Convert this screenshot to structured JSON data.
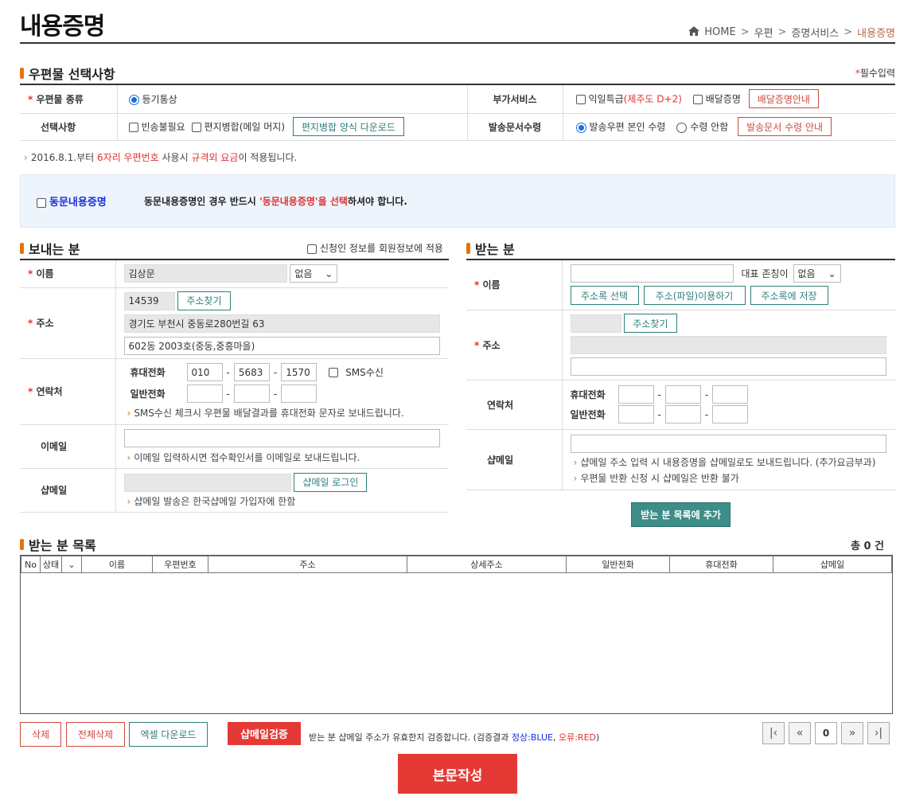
{
  "page": {
    "title": "내용증명"
  },
  "breadcrumb": {
    "home": "HOME",
    "sep": ">",
    "b1": "우편",
    "b2": "증명서비스",
    "b3": "내용증명"
  },
  "options": {
    "section": "우편물 선택사항",
    "required_mark": "*",
    "required_note": "필수입력",
    "mail_type_label": "우편물 종류",
    "mail_type_value": "등기통상",
    "extra_label": "부가서비스",
    "express_label": "익일특급",
    "express_note": "(제주도 D+2)",
    "delivery_proof": "배달증명",
    "delivery_guide_btn": "배달증명안내",
    "select_label": "선택사항",
    "empty_ok": "빈송불필요",
    "merge": "편지병합(메일 머지)",
    "merge_download_btn": "편지병합 양식 다운로드",
    "doc_receive_label": "발송문서수령",
    "doc_self": "발송우편 본인 수령",
    "doc_none": "수령 안함",
    "doc_guide_btn": "발송문서 수령 안내"
  },
  "notice": {
    "pre": "2016.8.1.부터 ",
    "red1": "6자리 우편번호",
    "mid": " 사용시 ",
    "red2": "규격외 요금",
    "post": "이 적용됩니다."
  },
  "same": {
    "label": "동문내용증명",
    "pre": "동문내용증명인 경우 반드시 ",
    "red": "'동문내용증명'을 선택",
    "post": "하셔야 합니다."
  },
  "sender": {
    "section": "보내는 분",
    "apply_member": "신청인 정보를 회원정보에 적용",
    "name_label": "이름",
    "name_value": "김상문",
    "title_select": "없음",
    "addr_label": "주소",
    "zip": "14539",
    "find_addr_btn": "주소찾기",
    "addr1": "경기도 부천시 중동로280번길 63",
    "addr2": "602동 2003호(중동,중흥마을)",
    "contact_label": "연락처",
    "mobile_label": "휴대전화",
    "mobile1": "010",
    "mobile2": "5683",
    "mobile3": "1570",
    "sms_label": "SMS수신",
    "phone_label": "일반전화",
    "dash": "-",
    "sms_hint": "SMS수신 체크시 우편물 배달결과를 휴대전화 문자로 보내드립니다.",
    "email_label": "이메일",
    "email_hint": "이메일 입력하시면 접수확인서를 이메일로 보내드립니다.",
    "shopmail_label": "샵메일",
    "shopmail_login_btn": "샵메일 로그인",
    "shopmail_hint": "샵메일 발송은 한국샵메일 가입자에 한함"
  },
  "receiver": {
    "section": "받는 분",
    "name_label": "이름",
    "honorific_label": "대표 존칭이",
    "honorific_select": "없음",
    "addrbook_btn": "주소록 선택",
    "file_btn": "주소(파일)이용하기",
    "save_btn": "주소록에 저장",
    "addr_label": "주소",
    "find_addr_btn": "주소찾기",
    "contact_label": "연락처",
    "mobile_label": "휴대전화",
    "phone_label": "일반전화",
    "dash": "-",
    "shopmail_label": "샵메일",
    "hint1": "샵메일 주소 입력 시 내용증명을 샵메일로도 보내드립니다. (추가요금부과)",
    "hint2": "우편물 반환 신청 시 샵메일은 반환 불가",
    "add_btn": "받는 분 목록에 추가"
  },
  "list": {
    "section": "받는 분 목록",
    "total": "총 0 건",
    "headers": [
      "No",
      "상태",
      "",
      "이름",
      "우편번호",
      "주소",
      "상세주소",
      "일반전화",
      "휴대전화",
      "샵메일"
    ]
  },
  "bottom": {
    "delete_btn": "삭제",
    "delete_all_btn": "전체삭제",
    "excel_btn": "엑셀 다운로드",
    "verify_btn": "샵메일검증",
    "verify_pre": "받는 분 샵메일 주소가 유효한지 검증합니다. (검증결과 ",
    "ok": "정상:BLUE",
    "comma": ", ",
    "err": "오류:RED",
    "close": ")",
    "page_num": "0",
    "write_btn": "본문작성"
  },
  "colors": {
    "accent": "#e8720c",
    "teal": "#2f7e7a",
    "red": "#d04a3c",
    "blue": "#1a2ee0",
    "notice_bg": "#eef4fb"
  }
}
